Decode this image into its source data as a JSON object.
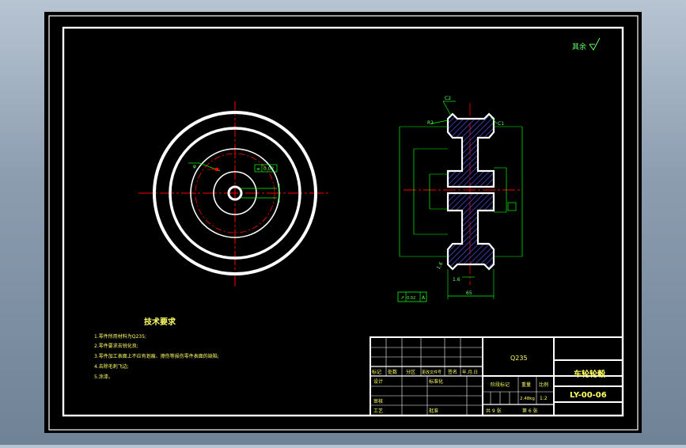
{
  "drawing": {
    "surface_finish_note": "其余",
    "tech_requirements": {
      "title": "技术要求",
      "items": [
        "1.零件所用材料为Q235;",
        "2.零件要求去锐化良;",
        "3.零件加工表面上不应有划痕、擦伤等损伤零件表面的缺陷;",
        "4.去除毛刺飞边;",
        "5.涂漆。"
      ]
    },
    "dims": {
      "front_tolerance": "0.02",
      "side_bottom_tolerance": "0.02",
      "width": "65",
      "chamfer_top": "C2",
      "chamfer_right": "C1",
      "chamfer_left": "R2",
      "rough_a": "1.6",
      "rough_b": "1.6"
    },
    "title_block": {
      "material": "Q235",
      "part_name": "车轮轮毂",
      "drawing_no": "LY-00-06",
      "header_cells": [
        "标记",
        "处数",
        "分区",
        "更改文件号",
        "签名",
        "年.月.日"
      ],
      "row_design": "设计",
      "row_standard": "标准化",
      "row_review": "审核",
      "row_process": "工艺",
      "row_approve": "批准",
      "stage_mark": "阶段标记",
      "weight_label": "重量",
      "scale_label": "比例",
      "weight_value": "2.48kg",
      "scale_value": "1:2",
      "sheets": "共 9 张",
      "sheet_no": "第 6 张"
    }
  },
  "colors": {
    "background": "#000000",
    "outline": "#ffffff",
    "dimension": "#00ff00",
    "centerline": "#ff0000",
    "hatch": "#3a3aa8",
    "text_yellow": "#ffff66",
    "text_green": "#66ff66"
  }
}
